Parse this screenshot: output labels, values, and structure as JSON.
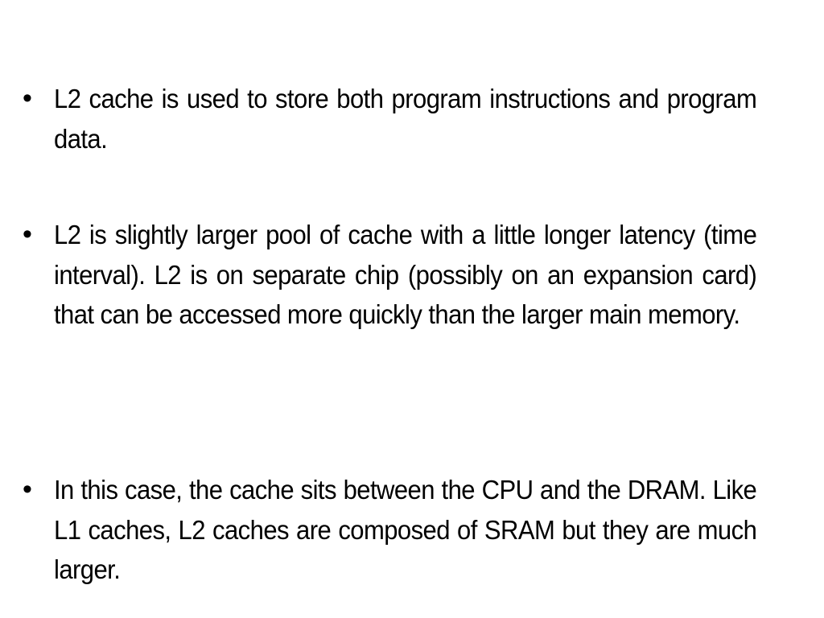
{
  "slide": {
    "bullets": [
      {
        "icon": "bullet-dot",
        "symbol": "•",
        "text": "L2 cache is used to store both program instructions and program data."
      },
      {
        "icon": "bullet-dot",
        "symbol": "•",
        "text": "L2 is slightly larger pool of cache with a little longer latency (time interval). L2 is on separate chip (possibly on an expansion card) that can be accessed more quickly than the larger main memory."
      },
      {
        "icon": "bullet-dot",
        "symbol": "•",
        "text": "In this case, the cache sits between the CPU and the DRAM. Like L1 caches, L2 caches are composed of SRAM but they are much larger."
      }
    ]
  }
}
